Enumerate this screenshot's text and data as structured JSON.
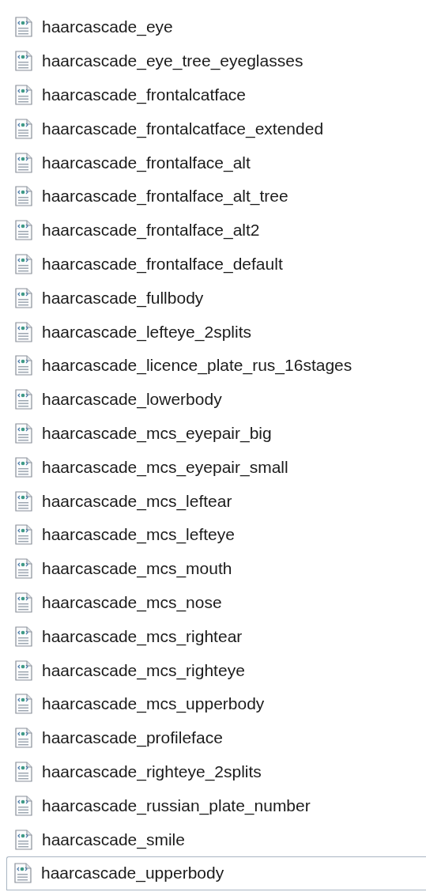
{
  "files": [
    {
      "name": "haarcascade_eye",
      "focused": false
    },
    {
      "name": "haarcascade_eye_tree_eyeglasses",
      "focused": false
    },
    {
      "name": "haarcascade_frontalcatface",
      "focused": false
    },
    {
      "name": "haarcascade_frontalcatface_extended",
      "focused": false
    },
    {
      "name": "haarcascade_frontalface_alt",
      "focused": false
    },
    {
      "name": "haarcascade_frontalface_alt_tree",
      "focused": false
    },
    {
      "name": "haarcascade_frontalface_alt2",
      "focused": false
    },
    {
      "name": "haarcascade_frontalface_default",
      "focused": false
    },
    {
      "name": "haarcascade_fullbody",
      "focused": false
    },
    {
      "name": "haarcascade_lefteye_2splits",
      "focused": false
    },
    {
      "name": "haarcascade_licence_plate_rus_16stages",
      "focused": false
    },
    {
      "name": "haarcascade_lowerbody",
      "focused": false
    },
    {
      "name": "haarcascade_mcs_eyepair_big",
      "focused": false
    },
    {
      "name": "haarcascade_mcs_eyepair_small",
      "focused": false
    },
    {
      "name": "haarcascade_mcs_leftear",
      "focused": false
    },
    {
      "name": "haarcascade_mcs_lefteye",
      "focused": false
    },
    {
      "name": "haarcascade_mcs_mouth",
      "focused": false
    },
    {
      "name": "haarcascade_mcs_nose",
      "focused": false
    },
    {
      "name": "haarcascade_mcs_rightear",
      "focused": false
    },
    {
      "name": "haarcascade_mcs_righteye",
      "focused": false
    },
    {
      "name": "haarcascade_mcs_upperbody",
      "focused": false
    },
    {
      "name": "haarcascade_profileface",
      "focused": false
    },
    {
      "name": "haarcascade_righteye_2splits",
      "focused": false
    },
    {
      "name": "haarcascade_russian_plate_number",
      "focused": false
    },
    {
      "name": "haarcascade_smile",
      "focused": false
    },
    {
      "name": "haarcascade_upperbody",
      "focused": true
    }
  ]
}
